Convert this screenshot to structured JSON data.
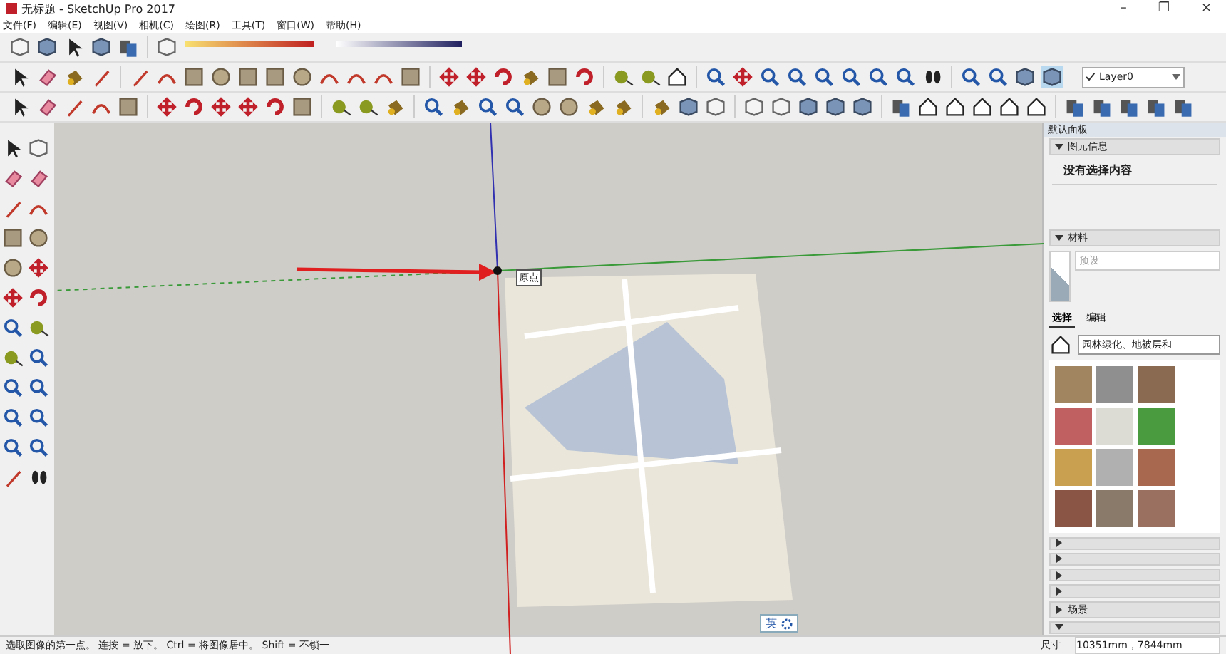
{
  "window": {
    "title": "无标题 - SketchUp Pro 2017",
    "controls": [
      "–",
      "❐",
      "×"
    ]
  },
  "menu": [
    "文件(F)",
    "编辑(E)",
    "视图(V)",
    "相机(C)",
    "绘图(R)",
    "工具(T)",
    "窗口(W)",
    "帮助(H)"
  ],
  "layer_select": {
    "value": "Layer0"
  },
  "viewport": {
    "origin_label": "原点"
  },
  "tray": {
    "title": "默认面板",
    "entity_info": {
      "title": "图元信息",
      "expanded": true,
      "message": "没有选择内容"
    },
    "materials": {
      "title": "材料",
      "expanded": true,
      "name_placeholder": "预设",
      "tabs": [
        {
          "label": "选择",
          "selected": true
        },
        {
          "label": "编辑",
          "selected": false
        }
      ],
      "library": "园林绿化、地被层和"
    },
    "collapsed": [
      {
        "expanded": false
      },
      {
        "expanded": false
      },
      {
        "expanded": false
      },
      {
        "expanded": false
      },
      {
        "title": "场景",
        "expanded": false
      },
      {
        "expanded": true
      }
    ]
  },
  "status_bar": {
    "hint": "选取图像的第一点。 连按 = 放下。 Ctrl = 将图像居中。 Shift = 不锁一",
    "measure_label": "尺寸",
    "measure_value": "10351mm，7844mm"
  },
  "ime": {
    "label": "英"
  }
}
